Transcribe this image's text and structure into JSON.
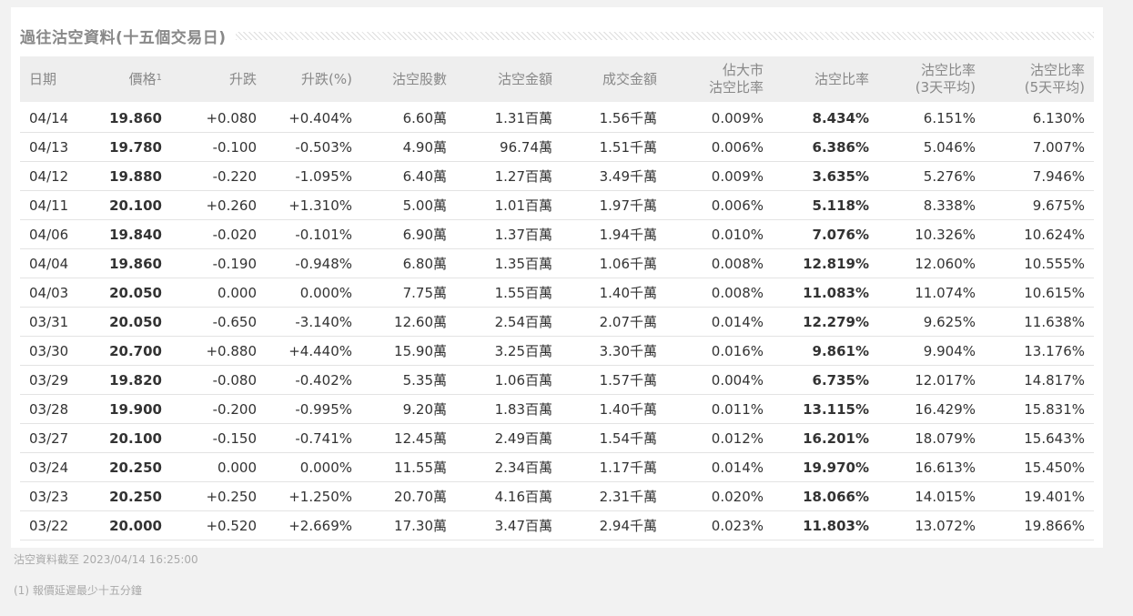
{
  "title": "過往沽空資料(十五個交易日)",
  "columns": {
    "date": "日期",
    "price": "價格",
    "price_sup": "1",
    "change": "升跌",
    "change_pct": "升跌(%)",
    "short_shares": "沽空股數",
    "short_amount": "沽空金額",
    "turnover": "成交金額",
    "market_ratio_l1": "佔大市",
    "market_ratio_l2": "沽空比率",
    "short_ratio": "沽空比率",
    "avg3_l1": "沽空比率",
    "avg3_l2": "(3天平均)",
    "avg5_l1": "沽空比率",
    "avg5_l2": "(5天平均)"
  },
  "rows": [
    {
      "date": "04/14",
      "price": "19.860",
      "change": "+0.080",
      "change_pct": "+0.404%",
      "dir": "up",
      "short_shares": "6.60萬",
      "short_amount": "1.31百萬",
      "turnover": "1.56千萬",
      "market_ratio": "0.009%",
      "short_ratio": "8.434%",
      "avg3": "6.151%",
      "avg5": "6.130%"
    },
    {
      "date": "04/13",
      "price": "19.780",
      "change": "-0.100",
      "change_pct": "-0.503%",
      "dir": "down",
      "short_shares": "4.90萬",
      "short_amount": "96.74萬",
      "turnover": "1.51千萬",
      "market_ratio": "0.006%",
      "short_ratio": "6.386%",
      "avg3": "5.046%",
      "avg5": "7.007%"
    },
    {
      "date": "04/12",
      "price": "19.880",
      "change": "-0.220",
      "change_pct": "-1.095%",
      "dir": "down",
      "short_shares": "6.40萬",
      "short_amount": "1.27百萬",
      "turnover": "3.49千萬",
      "market_ratio": "0.009%",
      "short_ratio": "3.635%",
      "avg3": "5.276%",
      "avg5": "7.946%"
    },
    {
      "date": "04/11",
      "price": "20.100",
      "change": "+0.260",
      "change_pct": "+1.310%",
      "dir": "up",
      "short_shares": "5.00萬",
      "short_amount": "1.01百萬",
      "turnover": "1.97千萬",
      "market_ratio": "0.006%",
      "short_ratio": "5.118%",
      "avg3": "8.338%",
      "avg5": "9.675%"
    },
    {
      "date": "04/06",
      "price": "19.840",
      "change": "-0.020",
      "change_pct": "-0.101%",
      "dir": "down",
      "short_shares": "6.90萬",
      "short_amount": "1.37百萬",
      "turnover": "1.94千萬",
      "market_ratio": "0.010%",
      "short_ratio": "7.076%",
      "avg3": "10.326%",
      "avg5": "10.624%"
    },
    {
      "date": "04/04",
      "price": "19.860",
      "change": "-0.190",
      "change_pct": "-0.948%",
      "dir": "down",
      "short_shares": "6.80萬",
      "short_amount": "1.35百萬",
      "turnover": "1.06千萬",
      "market_ratio": "0.008%",
      "short_ratio": "12.819%",
      "avg3": "12.060%",
      "avg5": "10.555%"
    },
    {
      "date": "04/03",
      "price": "20.050",
      "change": "0.000",
      "change_pct": "0.000%",
      "dir": "flat",
      "short_shares": "7.75萬",
      "short_amount": "1.55百萬",
      "turnover": "1.40千萬",
      "market_ratio": "0.008%",
      "short_ratio": "11.083%",
      "avg3": "11.074%",
      "avg5": "10.615%"
    },
    {
      "date": "03/31",
      "price": "20.050",
      "change": "-0.650",
      "change_pct": "-3.140%",
      "dir": "down",
      "short_shares": "12.60萬",
      "short_amount": "2.54百萬",
      "turnover": "2.07千萬",
      "market_ratio": "0.014%",
      "short_ratio": "12.279%",
      "avg3": "9.625%",
      "avg5": "11.638%"
    },
    {
      "date": "03/30",
      "price": "20.700",
      "change": "+0.880",
      "change_pct": "+4.440%",
      "dir": "up",
      "short_shares": "15.90萬",
      "short_amount": "3.25百萬",
      "turnover": "3.30千萬",
      "market_ratio": "0.016%",
      "short_ratio": "9.861%",
      "avg3": "9.904%",
      "avg5": "13.176%"
    },
    {
      "date": "03/29",
      "price": "19.820",
      "change": "-0.080",
      "change_pct": "-0.402%",
      "dir": "down",
      "short_shares": "5.35萬",
      "short_amount": "1.06百萬",
      "turnover": "1.57千萬",
      "market_ratio": "0.004%",
      "short_ratio": "6.735%",
      "avg3": "12.017%",
      "avg5": "14.817%"
    },
    {
      "date": "03/28",
      "price": "19.900",
      "change": "-0.200",
      "change_pct": "-0.995%",
      "dir": "down",
      "short_shares": "9.20萬",
      "short_amount": "1.83百萬",
      "turnover": "1.40千萬",
      "market_ratio": "0.011%",
      "short_ratio": "13.115%",
      "avg3": "16.429%",
      "avg5": "15.831%"
    },
    {
      "date": "03/27",
      "price": "20.100",
      "change": "-0.150",
      "change_pct": "-0.741%",
      "dir": "down",
      "short_shares": "12.45萬",
      "short_amount": "2.49百萬",
      "turnover": "1.54千萬",
      "market_ratio": "0.012%",
      "short_ratio": "16.201%",
      "avg3": "18.079%",
      "avg5": "15.643%"
    },
    {
      "date": "03/24",
      "price": "20.250",
      "change": "0.000",
      "change_pct": "0.000%",
      "dir": "flat",
      "short_shares": "11.55萬",
      "short_amount": "2.34百萬",
      "turnover": "1.17千萬",
      "market_ratio": "0.014%",
      "short_ratio": "19.970%",
      "avg3": "16.613%",
      "avg5": "15.450%"
    },
    {
      "date": "03/23",
      "price": "20.250",
      "change": "+0.250",
      "change_pct": "+1.250%",
      "dir": "up",
      "short_shares": "20.70萬",
      "short_amount": "4.16百萬",
      "turnover": "2.31千萬",
      "market_ratio": "0.020%",
      "short_ratio": "18.066%",
      "avg3": "14.015%",
      "avg5": "19.401%"
    },
    {
      "date": "03/22",
      "price": "20.000",
      "change": "+0.520",
      "change_pct": "+2.669%",
      "dir": "up",
      "short_shares": "17.30萬",
      "short_amount": "3.47百萬",
      "turnover": "2.94千萬",
      "market_ratio": "0.023%",
      "short_ratio": "11.803%",
      "avg3": "13.072%",
      "avg5": "19.866%"
    }
  ],
  "colors": {
    "up": "#2b9a2b",
    "down": "#d22d2d",
    "flat": "#333333"
  },
  "footer": {
    "as_of": "沽空資料截至 2023/04/14 16:25:00",
    "note": "(1) 報價延遲最少十五分鐘"
  }
}
